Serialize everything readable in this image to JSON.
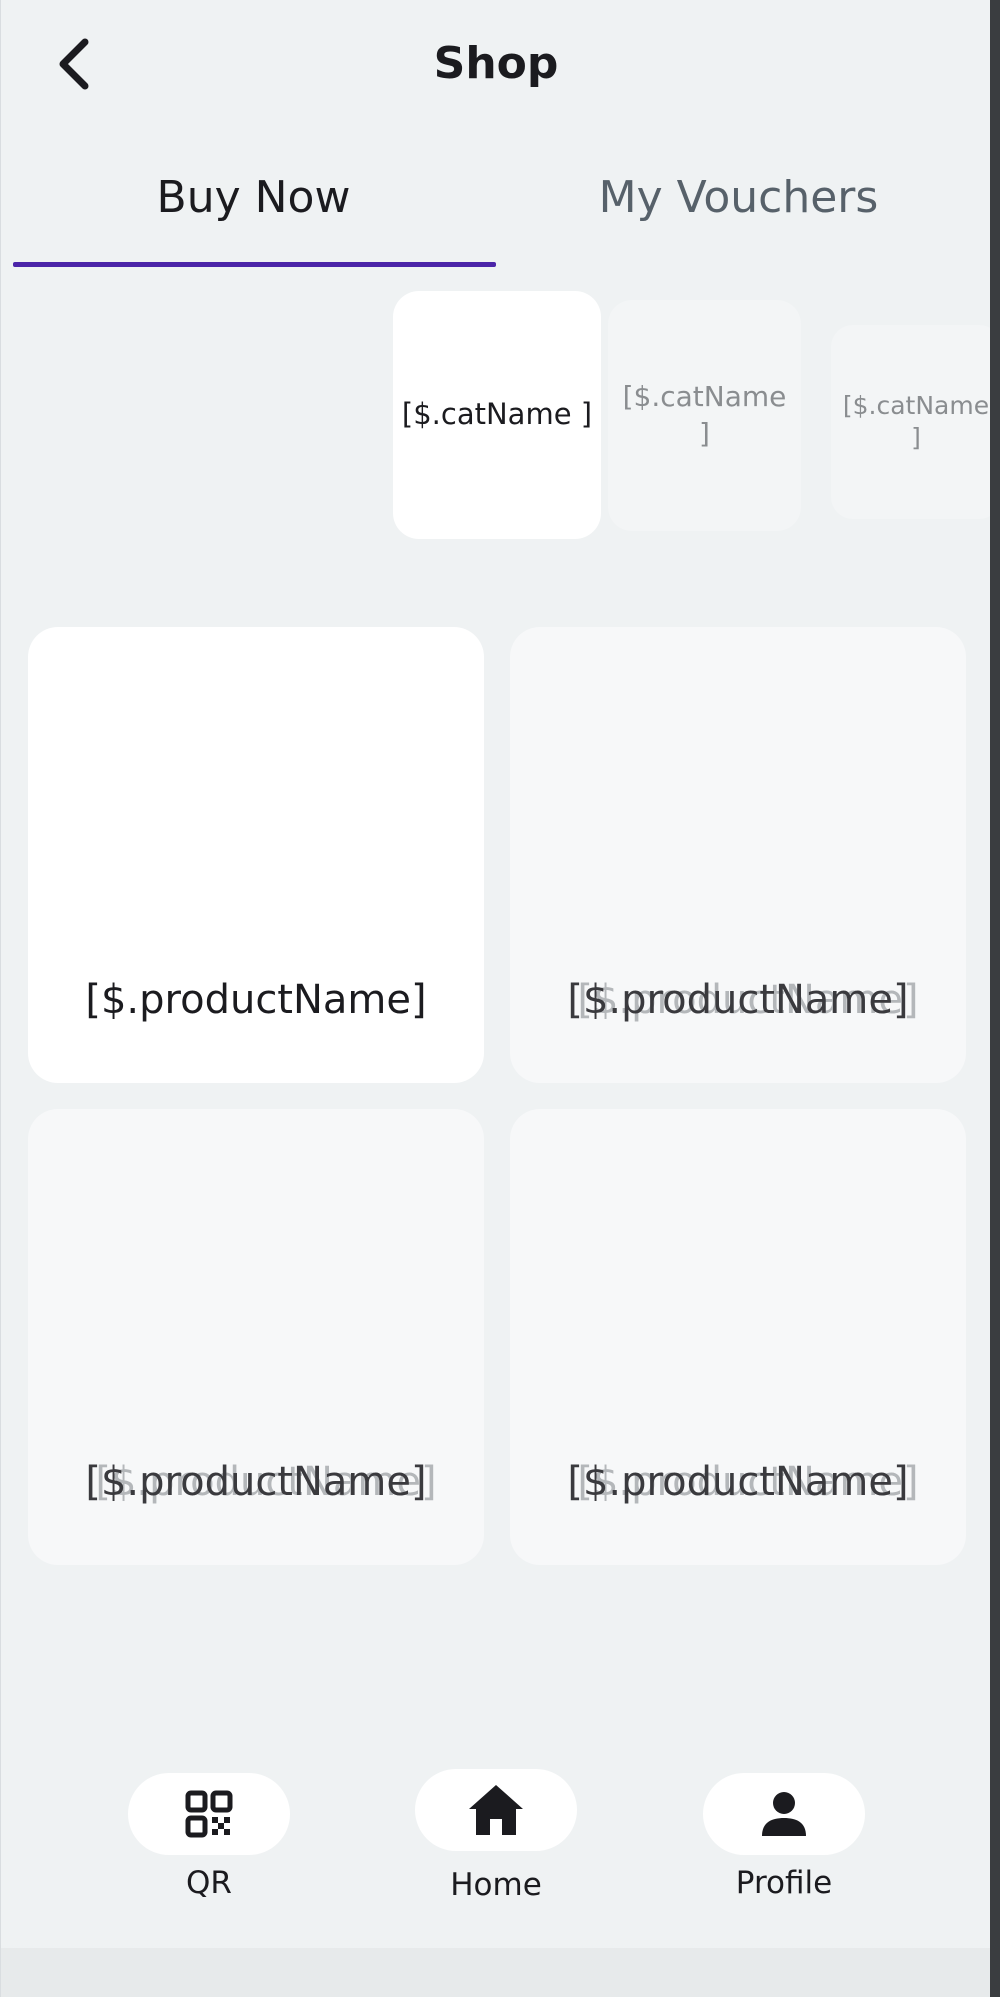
{
  "header": {
    "title": "Shop",
    "back_icon": "chevron-left-icon"
  },
  "tabs": [
    {
      "label": "Buy Now",
      "active": true
    },
    {
      "label": "My Vouchers",
      "active": false
    }
  ],
  "categories": [
    {
      "label": "[$.catName ]"
    },
    {
      "label": "[$.catName ]"
    },
    {
      "label": "[$.catName ]"
    }
  ],
  "products": [
    {
      "name": "[$.productName]"
    },
    {
      "name": "[$.productName]"
    },
    {
      "name": "[$.productName]"
    },
    {
      "name": "[$.productName]"
    }
  ],
  "nav": [
    {
      "label": "QR",
      "icon": "qr-code-icon"
    },
    {
      "label": "Home",
      "icon": "home-icon"
    },
    {
      "label": "Profile",
      "icon": "person-icon"
    }
  ],
  "colors": {
    "accent": "#4b25a8",
    "background": "#eff2f3",
    "card": "#ffffff"
  }
}
